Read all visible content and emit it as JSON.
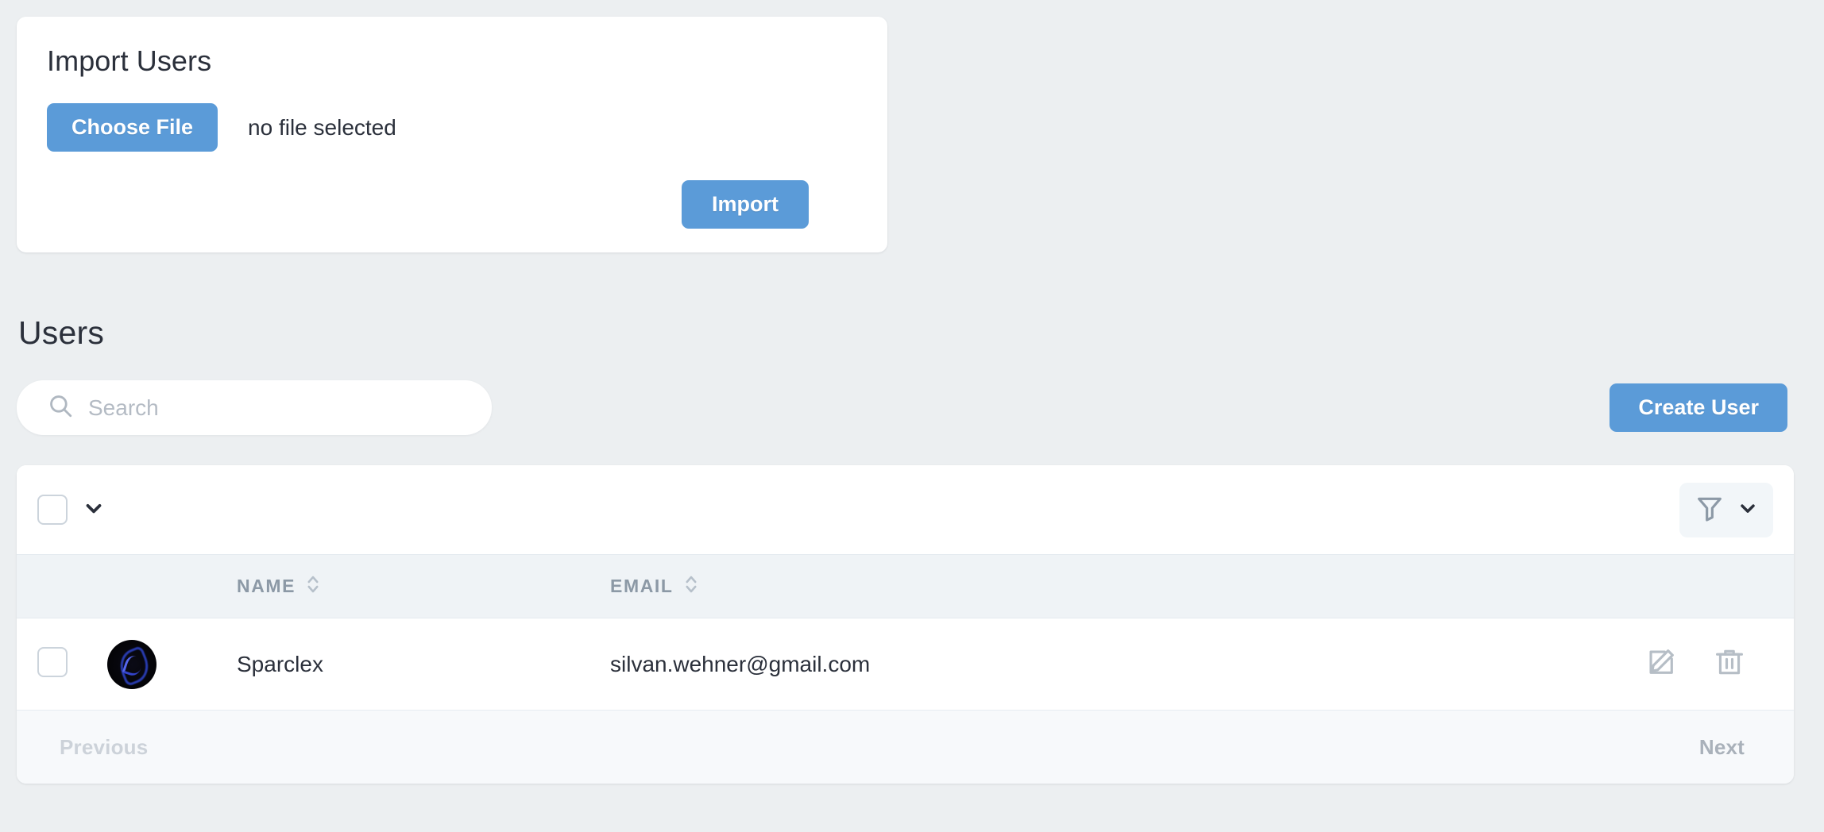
{
  "theme": {
    "page_background": "#eceff1",
    "accent_blue": "#5b9bd8",
    "text_dark": "#2b303b",
    "muted_gray": "#8c99a6",
    "header_row_bg": "#eff3f6",
    "footer_bg": "#f7f9fb"
  },
  "import_card": {
    "title": "Import Users",
    "choose_file_label": "Choose File",
    "file_status": "no file selected",
    "import_label": "Import"
  },
  "users_section": {
    "heading": "Users",
    "search": {
      "placeholder": "Search",
      "value": "",
      "icon": "search-icon"
    },
    "create_user_label": "Create User"
  },
  "table": {
    "toolbar": {
      "select_all_checked": false,
      "bulk_chevron_icon": "chevron-down-icon",
      "filter_icon": "filter-funnel-icon",
      "filter_chevron_icon": "chevron-down-icon"
    },
    "columns": [
      {
        "key": "select",
        "label": "",
        "sortable": false
      },
      {
        "key": "avatar",
        "label": "",
        "sortable": false
      },
      {
        "key": "name",
        "label": "NAME",
        "sortable": true
      },
      {
        "key": "email",
        "label": "EMAIL",
        "sortable": true
      },
      {
        "key": "actions",
        "label": "",
        "sortable": false
      }
    ],
    "rows": [
      {
        "selected": false,
        "avatar_alt": "user-avatar",
        "name": "Sparclex",
        "email": "silvan.wehner@gmail.com",
        "actions": [
          "edit-icon",
          "trash-icon"
        ]
      }
    ],
    "pagination": {
      "previous_label": "Previous",
      "next_label": "Next",
      "previous_enabled": false,
      "next_enabled": true
    }
  }
}
